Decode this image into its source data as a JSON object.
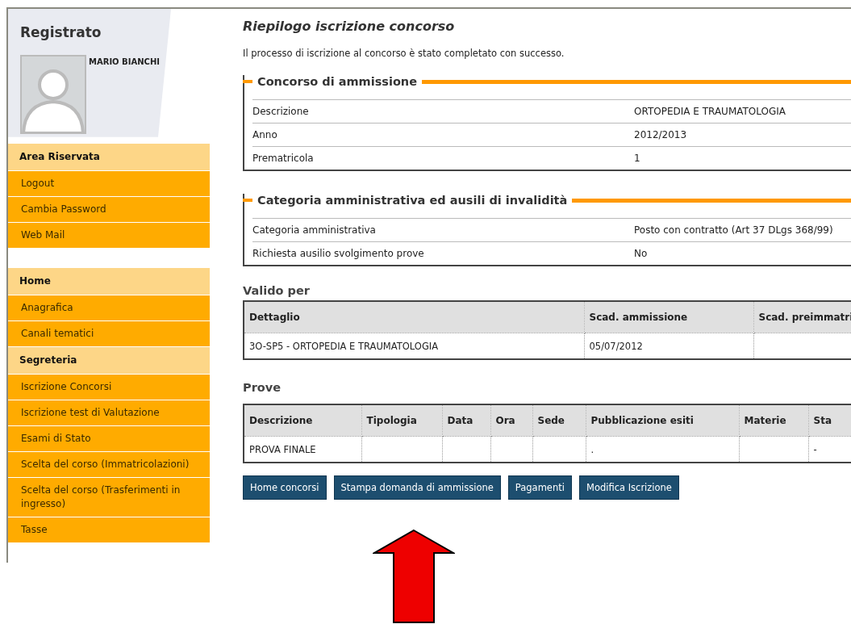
{
  "sidebar": {
    "title": "Registrato",
    "user_name": "MARIO BIANCHI",
    "menu_groups": [
      [
        {
          "kind": "header",
          "label": "Area Riservata"
        },
        {
          "kind": "item",
          "label": "Logout"
        },
        {
          "kind": "item",
          "label": "Cambia Password"
        },
        {
          "kind": "item",
          "label": "Web Mail"
        }
      ],
      [
        {
          "kind": "header",
          "label": "Home"
        },
        {
          "kind": "item",
          "label": "Anagrafica"
        },
        {
          "kind": "item",
          "label": "Canali tematici"
        },
        {
          "kind": "header",
          "label": "Segreteria"
        },
        {
          "kind": "item",
          "label": "Iscrizione Concorsi"
        },
        {
          "kind": "item",
          "label": "Iscrizione test di Valutazione"
        },
        {
          "kind": "item",
          "label": "Esami di Stato"
        },
        {
          "kind": "item",
          "label": "Scelta del corso (Immatricolazioni)"
        },
        {
          "kind": "item",
          "label": "Scelta del corso (Trasferimenti in ingresso)"
        },
        {
          "kind": "item",
          "label": "Tasse"
        }
      ]
    ]
  },
  "main": {
    "title": "Riepilogo iscrizione concorso",
    "message": "Il processo di iscrizione al concorso è stato completato con successo.",
    "sections": [
      {
        "title": "Concorso di ammissione",
        "rows": [
          {
            "label": "Descrizione",
            "value": "ORTOPEDIA E TRAUMATOLOGIA"
          },
          {
            "label": "Anno",
            "value": "2012/2013"
          },
          {
            "label": "Prematricola",
            "value": "1"
          }
        ]
      },
      {
        "title": "Categoria amministrativa ed ausili di invalidità",
        "rows": [
          {
            "label": "Categoria amministrativa",
            "value": "Posto con contratto (Art 37 DLgs 368/99)"
          },
          {
            "label": "Richiesta ausilio svolgimento prove",
            "value": "No"
          }
        ]
      }
    ],
    "tables": [
      {
        "title": "Valido per",
        "columns": [
          "Dettaglio",
          "Scad. ammissione",
          "Scad. preimmatri"
        ],
        "rows": [
          [
            "3O-SP5 - ORTOPEDIA E TRAUMATOLOGIA",
            "05/07/2012",
            ""
          ]
        ]
      },
      {
        "title": "Prove",
        "columns": [
          "Descrizione",
          "Tipologia",
          "Data",
          "Ora",
          "Sede",
          "Pubblicazione esiti",
          "Materie",
          "Sta"
        ],
        "rows": [
          [
            "PROVA FINALE",
            "",
            "",
            "",
            "",
            ".",
            "",
            "-"
          ]
        ]
      }
    ],
    "buttons": [
      "Home concorsi",
      "Stampa domanda di ammissione",
      "Pagamenti",
      "Modifica Iscrizione"
    ]
  }
}
